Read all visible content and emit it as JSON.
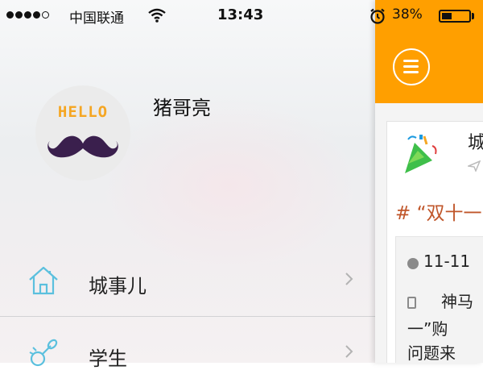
{
  "status_bar": {
    "carrier": "中国联通",
    "time": "13:43",
    "battery_percent": "38%",
    "battery_level": 0.38,
    "signal_bars_filled": 4,
    "signal_bars_total": 5
  },
  "drawer": {
    "avatar_text": "HELLO",
    "username": "猪哥亮",
    "menu": [
      {
        "label": "城事儿",
        "icon": "house-icon"
      },
      {
        "label": "学生",
        "icon": "pacifier-icon"
      }
    ]
  },
  "main": {
    "accent_color": "#ff9f00",
    "card": {
      "city": "城",
      "hashtag": "# “双十一",
      "date": "11-11",
      "line1": "神马",
      "line2": "一”购",
      "line3": "问题来"
    }
  },
  "colors": {
    "orange": "#ff9f00",
    "hello_text": "#f5a623",
    "mustache": "#3a1f4d",
    "menu_icon": "#5bc0de",
    "hashtag": "#c0562a"
  }
}
